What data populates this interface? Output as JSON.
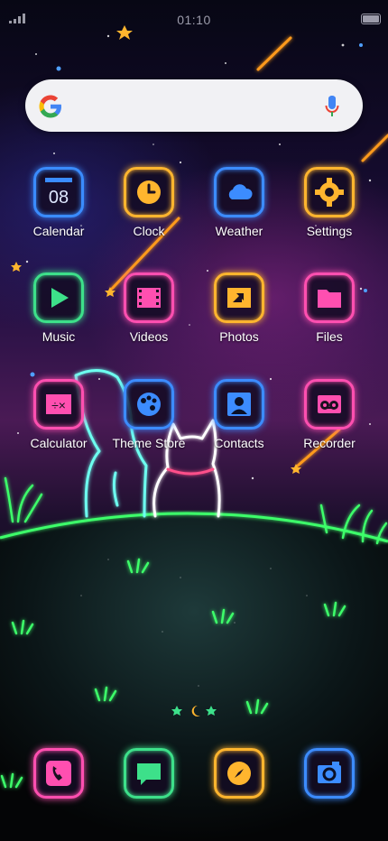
{
  "status": {
    "time": "01:10"
  },
  "search": {
    "mic": "mic-icon"
  },
  "apps": [
    {
      "label": "Calendar",
      "date": "08",
      "icon": "calendar-icon",
      "color": "#3a8cff"
    },
    {
      "label": "Clock",
      "icon": "clock-icon",
      "color": "#ffb52e"
    },
    {
      "label": "Weather",
      "icon": "cloud-icon",
      "color": "#3c8cff"
    },
    {
      "label": "Settings",
      "icon": "gear-icon",
      "color": "#ffb52e"
    },
    {
      "label": "Music",
      "icon": "play-icon",
      "color": "#3de08a"
    },
    {
      "label": "Videos",
      "icon": "film-icon",
      "color": "#ff4fb0"
    },
    {
      "label": "Photos",
      "icon": "photo-icon",
      "color": "#ffb52e"
    },
    {
      "label": "Files",
      "icon": "folder-icon",
      "color": "#ff4fb0"
    },
    {
      "label": "Calculator",
      "icon": "calculator-icon",
      "color": "#ff4fb0"
    },
    {
      "label": "Theme Store",
      "icon": "palette-icon",
      "color": "#3c8cff"
    },
    {
      "label": "Contacts",
      "icon": "contact-icon",
      "color": "#3c8cff"
    },
    {
      "label": "Recorder",
      "icon": "recorder-icon",
      "color": "#ff4fb0"
    }
  ],
  "dock": [
    {
      "icon": "phone-icon",
      "color": "#ff4fb0"
    },
    {
      "icon": "messages-icon",
      "color": "#3de08a"
    },
    {
      "icon": "browser-compass-icon",
      "color": "#ffb52e"
    },
    {
      "icon": "camera-icon",
      "color": "#3c8cff"
    }
  ],
  "pager": {
    "current_page": 2,
    "total_pages": 3
  }
}
